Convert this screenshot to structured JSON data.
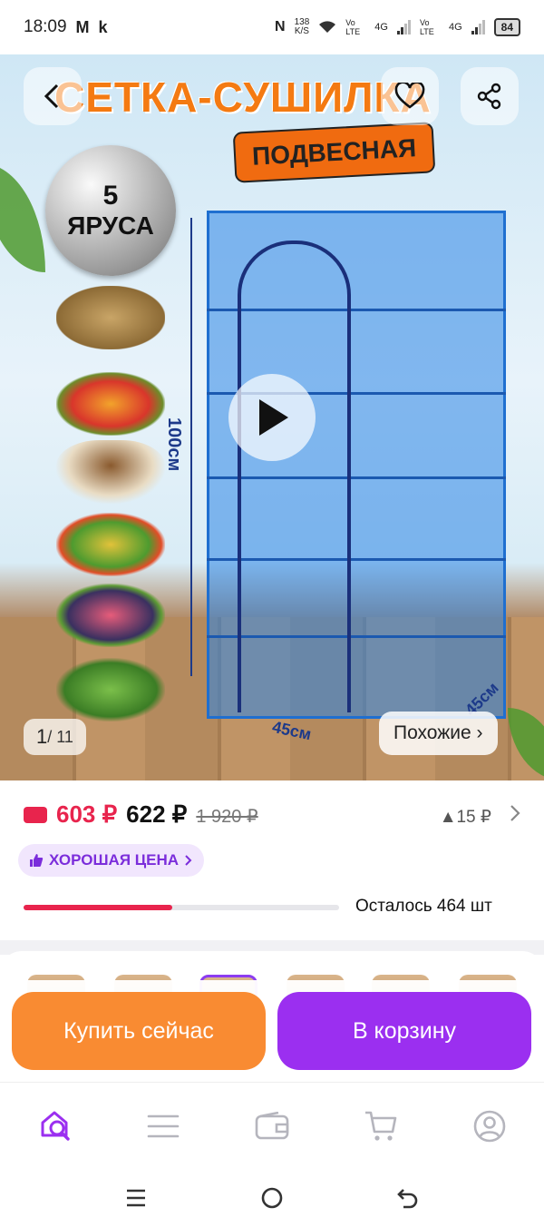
{
  "status_bar": {
    "time": "18:09",
    "app_icons": [
      "M",
      "k"
    ],
    "nfc": "N",
    "net_speed_value": "138",
    "net_speed_unit": "K/S",
    "sim1": "Vo LTE",
    "sim1_net": "4G",
    "sim2": "Vo LTE",
    "sim2_net": "4G",
    "battery": "84"
  },
  "hero": {
    "title": "СЕТКА-СУШИЛКА",
    "subtitle": "ПОДВЕСНАЯ",
    "tiers_number": "5",
    "tiers_label": "ЯРУСА",
    "height_label": "100см",
    "width_label": "45см",
    "depth_label": "45см",
    "counter_current": "1",
    "counter_total": "/ 11",
    "similar_label": "Похожие ›"
  },
  "price": {
    "card_price": "603 ₽",
    "price": "622 ₽",
    "old_price": "1 920 ₽",
    "delta": "▲15 ₽",
    "good_price_label": "ХОРОШАЯ ЦЕНА",
    "stock_left": "Осталось 464 шт",
    "stock_fraction": 0.47
  },
  "actions": {
    "buy_now": "Купить сейчас",
    "add_to_cart": "В корзину"
  },
  "icons": [
    "back-icon",
    "heart-icon",
    "share-icon",
    "play-icon",
    "wallet-icon",
    "like-icon",
    "chevron-right-icon",
    "search-icon",
    "catalog-icon",
    "wallet-tab-icon",
    "cart-icon",
    "profile-icon"
  ],
  "colors": {
    "accent_red": "#e8244d",
    "accent_purple": "#9b2ff0",
    "accent_orange": "#f98b32",
    "tab_active": "#9b2ff0"
  }
}
